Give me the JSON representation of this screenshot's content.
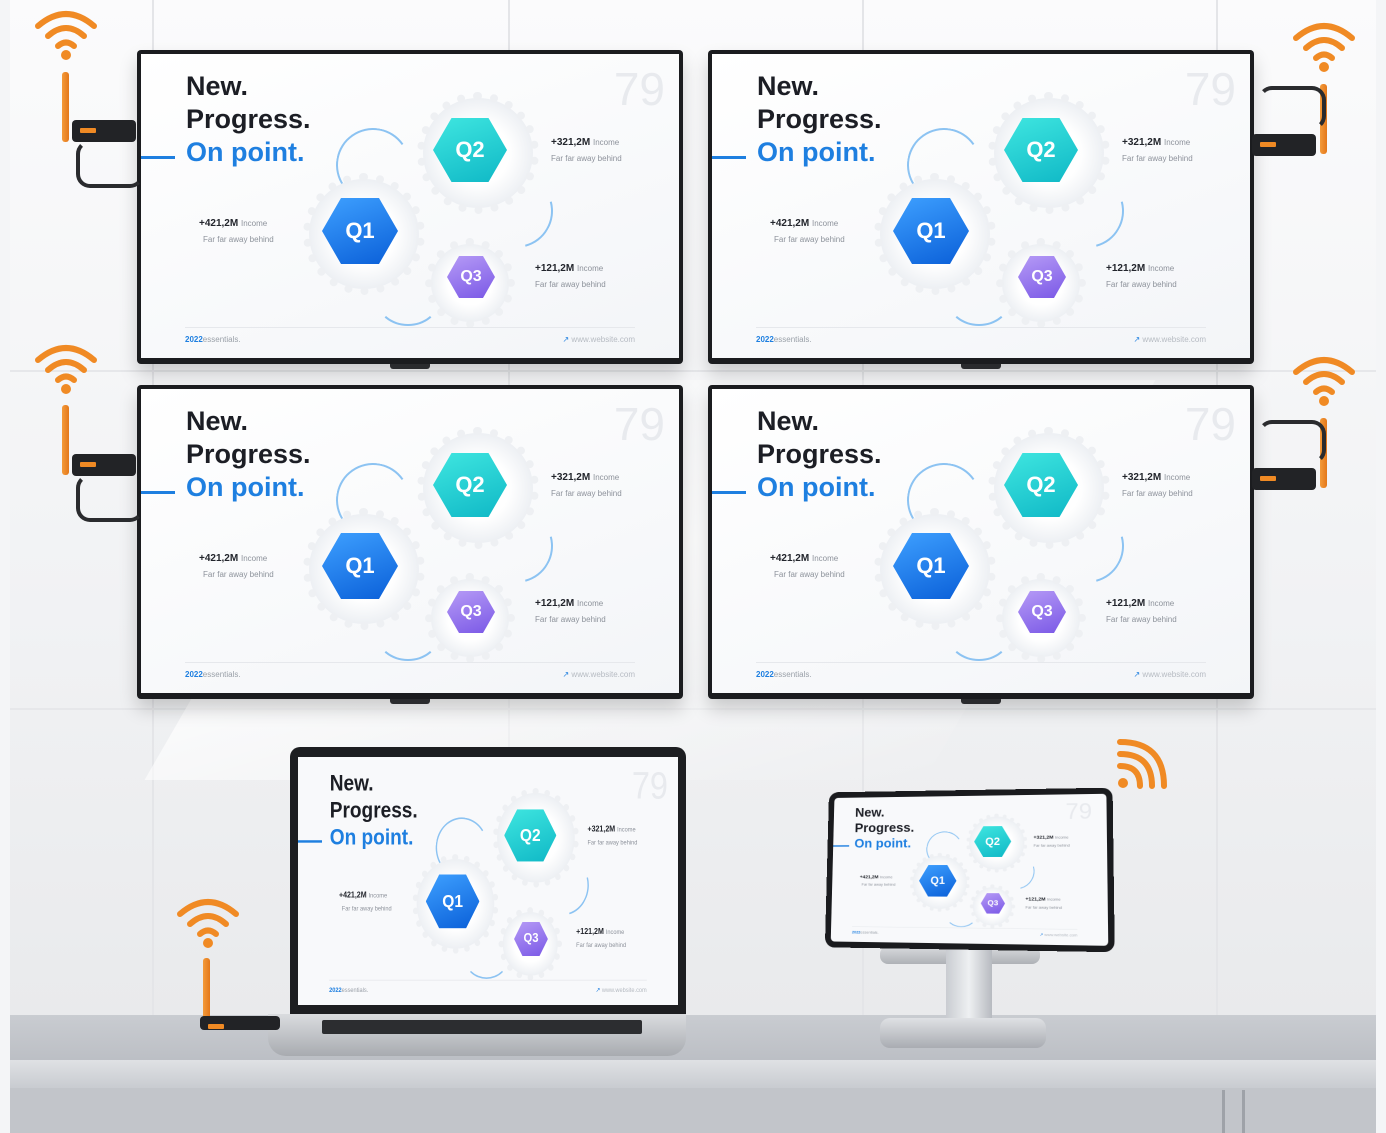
{
  "slide": {
    "line1": "New.",
    "line2": "Progress.",
    "line3": "On point.",
    "page_number": "79",
    "q1": "Q1",
    "q2": "Q2",
    "q3": "Q3",
    "stat_q1_value": "+421,2M",
    "stat_q2_value": "+321,2M",
    "stat_q3_value": "+121,2M",
    "stat_unit": "Income",
    "stat_sub": "Far far away behind",
    "footer_year": "2022",
    "footer_label": "essentials.",
    "footer_url": "www.website.com",
    "footer_arrow": "↗"
  },
  "colors": {
    "accent_blue": "#1e7fe0",
    "q1": "#1f7ff0",
    "q2": "#19c4cf",
    "q3": "#9373ee",
    "wifi_orange": "#f08a24"
  },
  "icons": [
    "wifi-icon",
    "antenna-icon",
    "hdmi-dongle-icon",
    "arrow-icon"
  ]
}
